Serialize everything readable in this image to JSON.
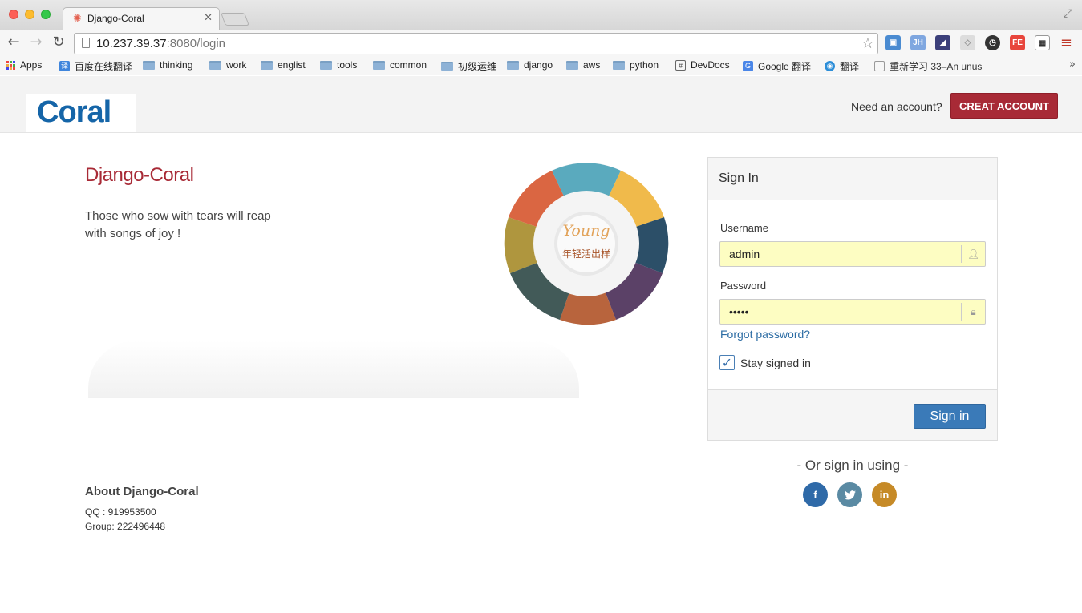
{
  "browser": {
    "tab_title": "Django-Coral",
    "url_host": "10.237.39.37",
    "url_rest": ":8080/login",
    "bookmarks": [
      {
        "label": "Apps",
        "icon": "apps-grid-icon"
      },
      {
        "label": "百度在线翻译",
        "icon": "translate-icon"
      },
      {
        "label": "thinking",
        "icon": "folder-icon"
      },
      {
        "label": "work",
        "icon": "folder-icon"
      },
      {
        "label": "englist",
        "icon": "folder-icon"
      },
      {
        "label": "tools",
        "icon": "folder-icon"
      },
      {
        "label": "common",
        "icon": "folder-icon"
      },
      {
        "label": "初级运维",
        "icon": "folder-icon"
      },
      {
        "label": "django",
        "icon": "folder-icon"
      },
      {
        "label": "aws",
        "icon": "folder-icon"
      },
      {
        "label": "python",
        "icon": "folder-icon"
      },
      {
        "label": "DevDocs",
        "icon": "hash-icon"
      },
      {
        "label": "Google 翻译",
        "icon": "google-translate-icon"
      },
      {
        "label": "翻译",
        "icon": "translate-icon"
      },
      {
        "label": "重新学习 33–An unus",
        "icon": "page-icon"
      }
    ],
    "extensions": [
      "JH",
      "FE"
    ]
  },
  "header": {
    "logo_text": "Coral",
    "need_account": "Need an account?",
    "create_button": "CREAT ACCOUNT"
  },
  "hero": {
    "title": "Django-Coral",
    "tagline": "Those who sow with tears will reap with songs of joy !",
    "badge_text_en": "Young",
    "badge_text_cn": "年轻活出样"
  },
  "about": {
    "title": "About Django-Coral",
    "qq": "QQ : 919953500",
    "group": "Group: 222496448"
  },
  "signin": {
    "title": "Sign In",
    "username_label": "Username",
    "username_value": "admin",
    "password_label": "Password",
    "password_value": "•••••",
    "forgot": "Forgot password?",
    "stay_signed_in": "Stay signed in",
    "stay_checked": true,
    "submit": "Sign in",
    "or_sign_in": "- Or sign in using -",
    "social": [
      {
        "label": "f",
        "name": "facebook",
        "color": "#2f6aa8"
      },
      {
        "label": "t",
        "name": "twitter",
        "color": "#5a8aa3"
      },
      {
        "label": "in",
        "name": "linkedin",
        "color": "#c68a27"
      }
    ]
  },
  "colors": {
    "brand_red": "#a82a36",
    "brand_blue": "#1565a8",
    "button_blue": "#3a7ab8",
    "autofill_yellow": "#fdfdc2"
  }
}
